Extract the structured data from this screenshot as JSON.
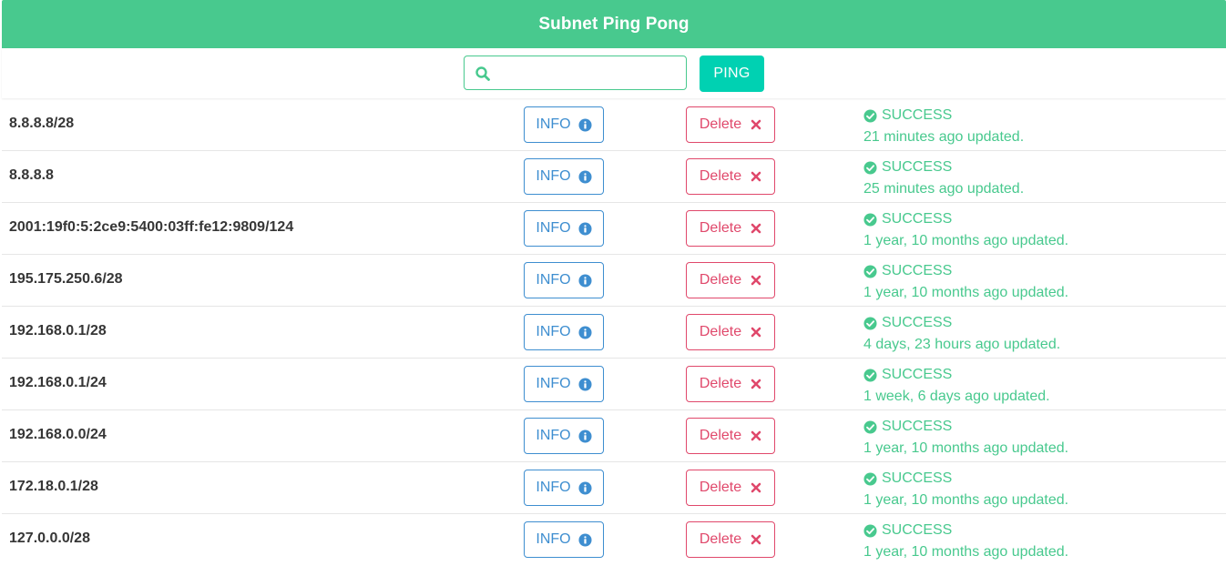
{
  "header": {
    "title": "Subnet Ping Pong"
  },
  "toolbar": {
    "search_value": "",
    "search_placeholder": "",
    "ping_label": "PING"
  },
  "colors": {
    "brand": "#48c98e",
    "primary": "#00d1b2",
    "info": "#3e8ed0",
    "danger": "#e0486b"
  },
  "icons": {
    "search": "search-icon",
    "info": "info-circle-icon",
    "delete": "close-icon",
    "status": "check-circle-icon"
  },
  "labels": {
    "info": "INFO",
    "delete": "Delete"
  },
  "rows": [
    {
      "subnet": "8.8.8.8/28",
      "status": "SUCCESS",
      "updated": "21 minutes ago updated."
    },
    {
      "subnet": "8.8.8.8",
      "status": "SUCCESS",
      "updated": "25 minutes ago updated."
    },
    {
      "subnet": "2001:19f0:5:2ce9:5400:03ff:fe12:9809/124",
      "status": "SUCCESS",
      "updated": "1 year, 10 months ago updated."
    },
    {
      "subnet": "195.175.250.6/28",
      "status": "SUCCESS",
      "updated": "1 year, 10 months ago updated."
    },
    {
      "subnet": "192.168.0.1/28",
      "status": "SUCCESS",
      "updated": "4 days, 23 hours ago updated."
    },
    {
      "subnet": "192.168.0.1/24",
      "status": "SUCCESS",
      "updated": "1 week, 6 days ago updated."
    },
    {
      "subnet": "192.168.0.0/24",
      "status": "SUCCESS",
      "updated": "1 year, 10 months ago updated."
    },
    {
      "subnet": "172.18.0.1/28",
      "status": "SUCCESS",
      "updated": "1 year, 10 months ago updated."
    },
    {
      "subnet": "127.0.0.0/28",
      "status": "SUCCESS",
      "updated": "1 year, 10 months ago updated."
    }
  ]
}
